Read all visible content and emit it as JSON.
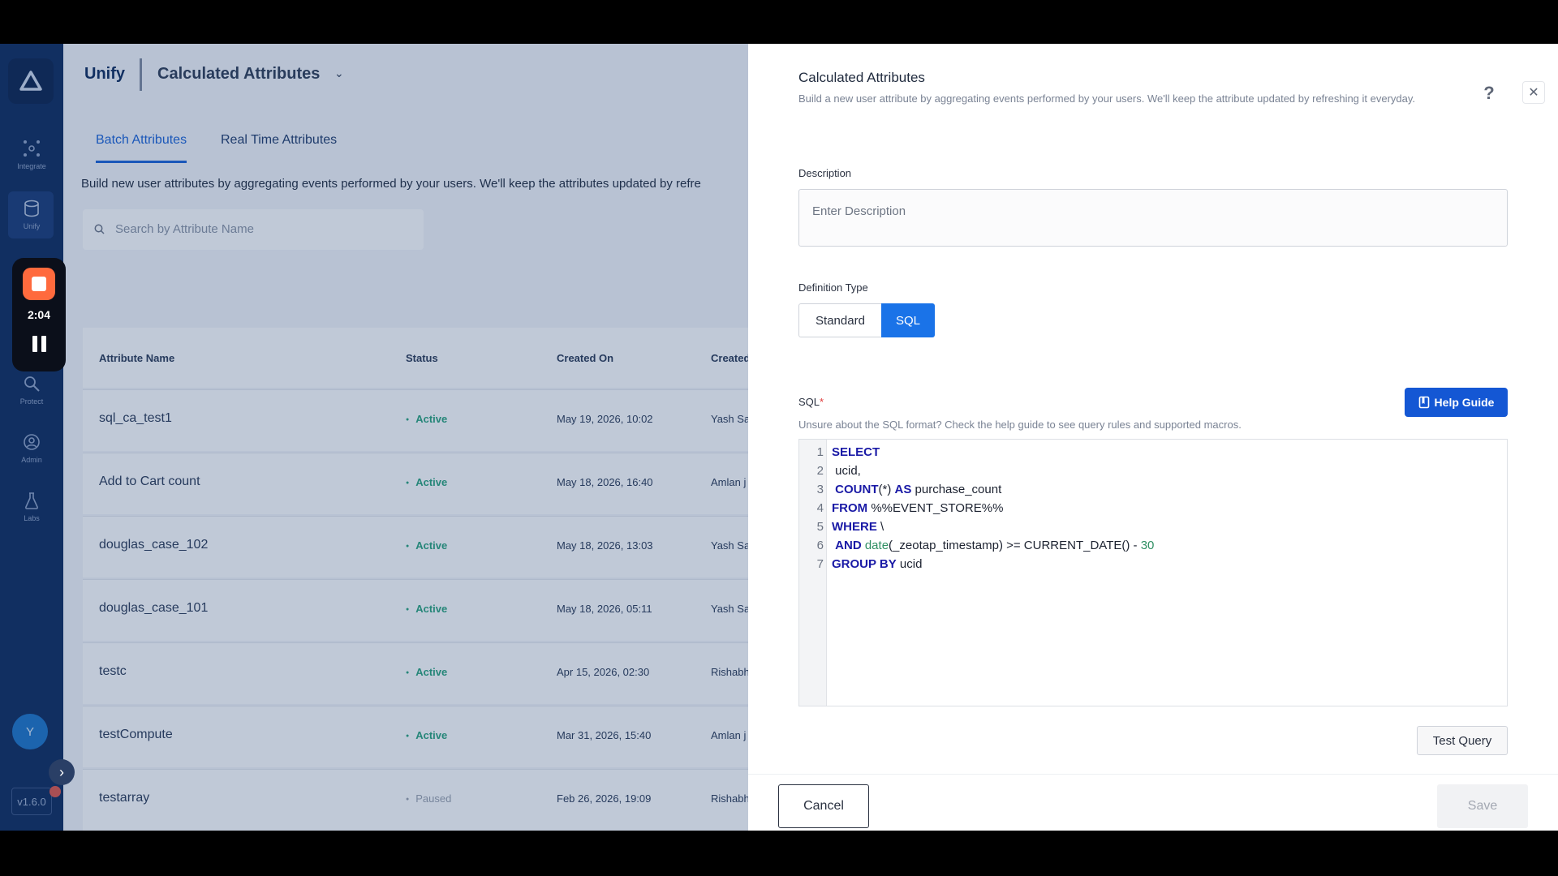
{
  "rail": {
    "items": [
      {
        "label": "Integrate",
        "icon": "integrate-icon"
      },
      {
        "label": "Unify",
        "icon": "database-icon"
      },
      {
        "label": "Protect",
        "icon": "protect-icon"
      },
      {
        "label": "Admin",
        "icon": "admin-icon"
      },
      {
        "label": "Labs",
        "icon": "flask-icon"
      }
    ],
    "avatar_initial": "Y",
    "version": "v1.6.0"
  },
  "recorder": {
    "time": "2:04"
  },
  "header": {
    "brand": "Unify",
    "page_name": "Calculated Attributes"
  },
  "tabs": [
    {
      "label": "Batch Attributes",
      "active": true
    },
    {
      "label": "Real Time Attributes",
      "active": false
    }
  ],
  "intro_text": "Build new user attributes by aggregating events performed by your users. We'll keep the attributes updated by refre",
  "search": {
    "placeholder": "Search by Attribute Name"
  },
  "table": {
    "columns": [
      "Attribute Name",
      "Status",
      "Created On",
      "Created"
    ],
    "rows": [
      {
        "name": "sql_ca_test1",
        "status": "Active",
        "created_on": "May 19, 2026, 10:02",
        "created_by": "Yash Sai"
      },
      {
        "name": "Add to Cart count",
        "status": "Active",
        "created_on": "May 18, 2026, 16:40",
        "created_by": "Amlan j"
      },
      {
        "name": "douglas_case_102",
        "status": "Active",
        "created_on": "May 18, 2026, 13:03",
        "created_by": "Yash Sai"
      },
      {
        "name": "douglas_case_101",
        "status": "Active",
        "created_on": "May 18, 2026, 05:11",
        "created_by": "Yash Sai"
      },
      {
        "name": "testc",
        "status": "Active",
        "created_on": "Apr 15, 2026, 02:30",
        "created_by": "Rishabh"
      },
      {
        "name": "testCompute",
        "status": "Active",
        "created_on": "Mar 31, 2026, 15:40",
        "created_by": "Amlan j"
      },
      {
        "name": "testarray",
        "status": "Paused",
        "created_on": "Feb 26, 2026, 19:09",
        "created_by": "Rishabh"
      }
    ]
  },
  "panel": {
    "title": "Calculated Attributes",
    "subtitle": "Build a new user attribute by aggregating events performed by your users. We'll keep the attribute updated by refreshing it everyday.",
    "help_icon": "?",
    "close_icon": "✕",
    "description_label": "Description",
    "description_placeholder": "Enter Description",
    "definition_type_label": "Definition Type",
    "definition_options": [
      "Standard",
      "SQL"
    ],
    "definition_selected": "SQL",
    "sql_label": "SQL",
    "sql_required_mark": "*",
    "help_guide_label": "Help Guide",
    "sql_hint": "Unsure about the SQL format? Check the help guide to see query rules and supported macros.",
    "sql_lines": [
      "SELECT",
      " ucid,",
      " COUNT(*) AS purchase_count",
      "FROM %%EVENT_STORE%%",
      "WHERE \\",
      " AND date(_zeotap_timestamp) >= CURRENT_DATE() - 30",
      "GROUP BY ucid"
    ],
    "test_query_label": "Test Query",
    "cancel_label": "Cancel",
    "save_label": "Save"
  },
  "colors": {
    "rail": "#0d2a5c",
    "accent": "#1a73e8",
    "active_status": "#2aa37d",
    "recorder_stop": "#ff6a3d"
  }
}
